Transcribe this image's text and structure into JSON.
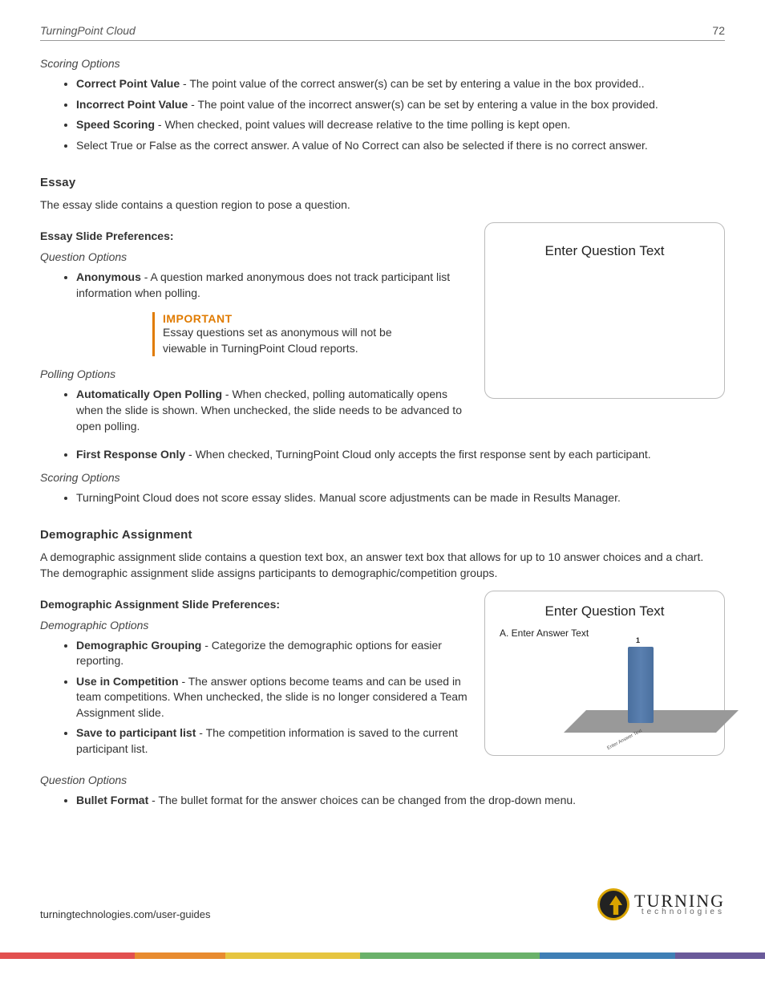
{
  "header": {
    "title": "TurningPoint Cloud",
    "page": "72"
  },
  "scoringOptionsTop": {
    "heading": "Scoring Options",
    "items": [
      {
        "term": "Correct Point Value",
        "desc": " - The point value of the correct answer(s) can be set by entering a value in the box provided.."
      },
      {
        "term": "Incorrect Point Value",
        "desc": " - The point value of the incorrect answer(s) can be set by entering a value in the box provided."
      },
      {
        "term": "Speed Scoring",
        "desc": " - When checked, point values will decrease relative to the time polling is kept open."
      },
      {
        "term": "",
        "desc": "Select True or False as the correct answer. A value of No Correct can also be selected if there is no correct answer."
      }
    ]
  },
  "essay": {
    "heading": "Essay",
    "intro": "The essay slide contains a question region to pose a question.",
    "prefsLabel": "Essay Slide Preferences:",
    "questionOptions": {
      "heading": "Question Options",
      "items": [
        {
          "term": "Anonymous",
          "desc": " - A question marked anonymous does not track participant list information when polling."
        }
      ]
    },
    "important": {
      "label": "IMPORTANT",
      "text": "Essay questions set as anonymous will not be viewable in TurningPoint Cloud reports."
    },
    "pollingOptions": {
      "heading": "Polling Options",
      "items": [
        {
          "term": "Automatically Open Polling",
          "desc": " - When checked, polling automatically opens when the slide is shown. When unchecked, the slide needs to be advanced to open polling."
        },
        {
          "term": "First Response Only",
          "desc": " - When checked, TurningPoint Cloud only accepts the first response sent by each participant."
        }
      ]
    },
    "scoringOptions": {
      "heading": "Scoring Options",
      "items": [
        {
          "term": "",
          "desc": "TurningPoint Cloud does not score essay slides. Manual score adjustments can be made in Results Manager."
        }
      ]
    },
    "figure": {
      "questionText": "Enter Question Text"
    }
  },
  "demographic": {
    "heading": "Demographic Assignment",
    "intro": "A demographic assignment slide contains a question text box, an answer text box that allows for up to 10 answer choices and a chart. The demographic assignment slide assigns participants to demographic/competition groups.",
    "prefsLabel": "Demographic Assignment Slide Preferences:",
    "demoOptions": {
      "heading": "Demographic Options",
      "items": [
        {
          "term": "Demographic Grouping",
          "desc": " - Categorize the demographic options for easier reporting."
        },
        {
          "term": "Use in Competition",
          "desc": " - The answer options become teams and can be used in team competitions. When unchecked, the slide is no longer considered a Team Assignment slide."
        },
        {
          "term": "Save to participant list",
          "desc": " - The competition information is saved to the current participant list."
        }
      ]
    },
    "questionOptions": {
      "heading": "Question Options",
      "items": [
        {
          "term": "Bullet Format",
          "desc": " - The bullet format for the answer choices can be changed from the drop-down menu."
        }
      ]
    },
    "figure": {
      "questionText": "Enter Question Text",
      "answerLine": "A.  Enter Answer Text",
      "barLabel": "1",
      "floorLabel": "Enter Answer Text"
    }
  },
  "chart_data": {
    "type": "bar",
    "categories": [
      "Enter Answer Text"
    ],
    "values": [
      1
    ],
    "title": "",
    "xlabel": "",
    "ylabel": "",
    "ylim": [
      0,
      1
    ]
  },
  "footer": {
    "url": "turningtechnologies.com/user-guides",
    "logoMain": "TURNING",
    "logoSub": "technologies"
  }
}
